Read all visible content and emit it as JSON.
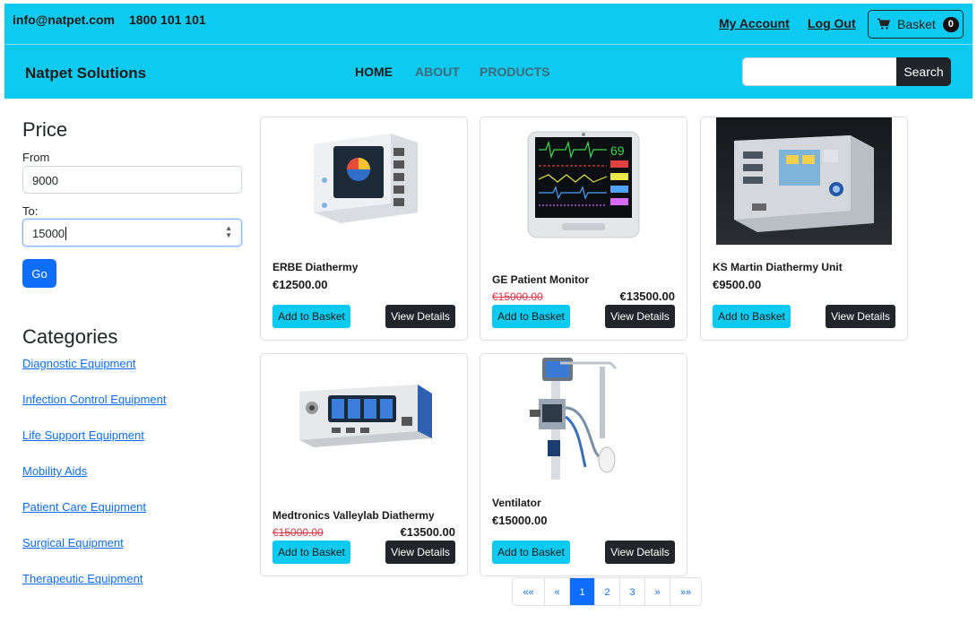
{
  "topbar": {
    "email": "info@natpet.com",
    "phone": "1800 101 101",
    "my_account": "My Account",
    "logout": "Log Out",
    "basket_label": "Basket",
    "basket_count": "0"
  },
  "navbar": {
    "brand": "Natpet Solutions",
    "links": [
      "HOME",
      "ABOUT",
      "PRODUCTS"
    ],
    "search_button": "Search"
  },
  "sidebar": {
    "price_heading": "Price",
    "from_label": "From",
    "from_value": "9000",
    "to_label": "To:",
    "to_value": "15000",
    "go_button": "Go",
    "categories_heading": "Categories",
    "categories": [
      "Diagnostic Equipment",
      "Infection Control Equipment",
      "Life Support Equipment",
      "Mobility Aids",
      "Patient Care Equipment",
      "Surgical Equipment",
      "Therapeutic Equipment"
    ]
  },
  "products": [
    {
      "name": "ERBE Diathermy",
      "price": "€12500.00",
      "image_icon": "diathermy-unit-image"
    },
    {
      "name": "GE Patient Monitor",
      "old_price": "€15000.00",
      "sale_price": "€13500.00",
      "image_icon": "patient-monitor-image"
    },
    {
      "name": "KS Martin Diathermy Unit",
      "price": "€9500.00",
      "image_icon": "diathermy-unit-dark-image"
    },
    {
      "name": "Medtronics Valleylab Diathermy",
      "old_price": "€15000.00",
      "sale_price": "€13500.00",
      "image_icon": "valleylab-image"
    },
    {
      "name": "Ventilator",
      "price": "€15000.00",
      "image_icon": "ventilator-image"
    }
  ],
  "buttons": {
    "add": "Add to Basket",
    "view": "View Details"
  },
  "pagination": [
    "««",
    "«",
    "1",
    "2",
    "3",
    "»",
    "»»"
  ],
  "pagination_active": "1",
  "colors": {
    "accent": "#0dcaf0",
    "primary": "#0d6efd",
    "dark": "#212529",
    "sale": "#dc3545"
  }
}
